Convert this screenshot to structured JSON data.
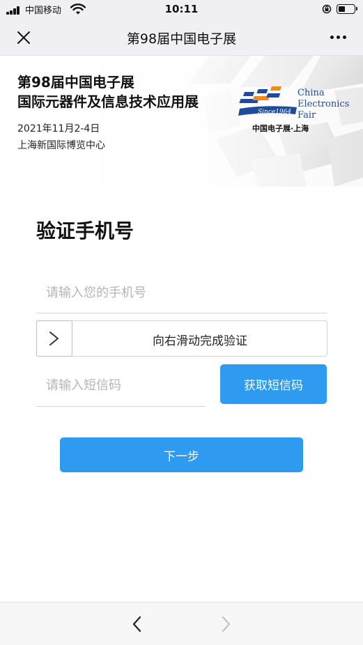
{
  "status_bar": {
    "carrier": "中国移动",
    "time": "10:11",
    "battery_level": 0.45
  },
  "nav": {
    "title": "第98届中国电子展",
    "close_icon": "close-icon",
    "more_icon": "more-dots-icon"
  },
  "banner": {
    "title_line1": "第98届中国电子展",
    "title_line2": "国际元器件及信息技术应用展",
    "date": "2021年11月2-4日",
    "venue": "上海新国际博览中心",
    "logo": {
      "en_line1": "China",
      "en_line2": "Electronics",
      "en_line3": "Fair",
      "since": "Since1964",
      "cn": "中国电子展·上海",
      "colors": {
        "blue": "#1f4a9e",
        "orange": "#f08a1c"
      }
    }
  },
  "form": {
    "heading": "验证手机号",
    "phone_placeholder": "请输入您的手机号",
    "slider_label": "向右滑动完成验证",
    "sms_placeholder": "请输入短信码",
    "sms_button": "获取短信码",
    "next_button": "下一步"
  },
  "colors": {
    "accent": "#2f9bf0"
  },
  "toolbar": {
    "back_icon": "back-arrow-icon",
    "forward_icon": "forward-arrow-icon"
  }
}
